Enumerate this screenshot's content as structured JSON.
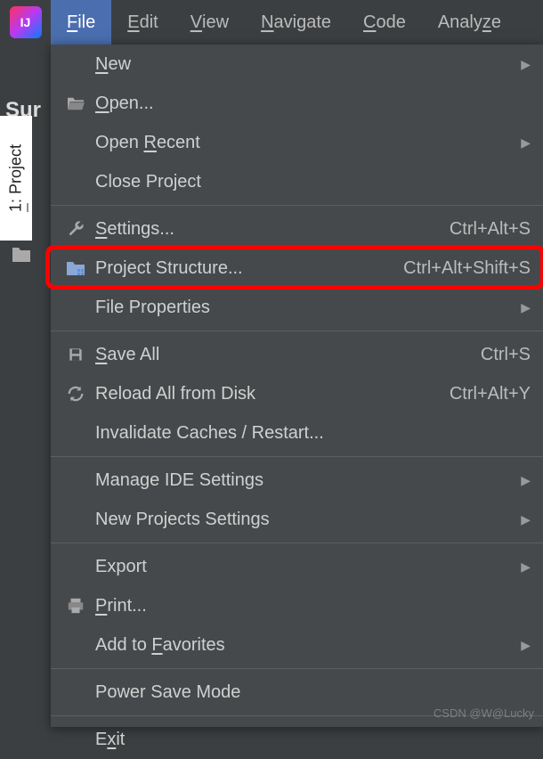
{
  "menubar": {
    "items": [
      {
        "label": "File",
        "mn": "F",
        "active": true
      },
      {
        "label": "Edit",
        "mn": "E",
        "active": false
      },
      {
        "label": "View",
        "mn": "V",
        "active": false
      },
      {
        "label": "Navigate",
        "mn": "N",
        "active": false
      },
      {
        "label": "Code",
        "mn": "C",
        "active": false
      },
      {
        "label": "Analyze",
        "mn": "z",
        "active": false
      }
    ]
  },
  "sidebar": {
    "tab_label": "1: Project",
    "tab_mn": "1",
    "truncated_label": "Sur"
  },
  "dropdown": {
    "items": [
      {
        "type": "item",
        "label": "New",
        "mn": "N",
        "submenu": true,
        "icon": ""
      },
      {
        "type": "item",
        "label": "Open...",
        "mn": "O",
        "icon": "open-folder-icon"
      },
      {
        "type": "item",
        "label": "Open Recent",
        "mn": "R",
        "submenu": true
      },
      {
        "type": "item",
        "label": "Close Project"
      },
      {
        "type": "sep"
      },
      {
        "type": "item",
        "label": "Settings...",
        "mn": "S",
        "shortcut": "Ctrl+Alt+S",
        "icon": "wrench-icon"
      },
      {
        "type": "item",
        "label": "Project Structure...",
        "shortcut": "Ctrl+Alt+Shift+S",
        "icon": "project-structure-icon",
        "highlight": true
      },
      {
        "type": "item",
        "label": "File Properties",
        "submenu": true
      },
      {
        "type": "sep"
      },
      {
        "type": "item",
        "label": "Save All",
        "mn": "S",
        "shortcut": "Ctrl+S",
        "icon": "save-icon"
      },
      {
        "type": "item",
        "label": "Reload All from Disk",
        "shortcut": "Ctrl+Alt+Y",
        "icon": "reload-icon"
      },
      {
        "type": "item",
        "label": "Invalidate Caches / Restart..."
      },
      {
        "type": "sep"
      },
      {
        "type": "item",
        "label": "Manage IDE Settings",
        "submenu": true
      },
      {
        "type": "item",
        "label": "New Projects Settings",
        "submenu": true
      },
      {
        "type": "sep"
      },
      {
        "type": "item",
        "label": "Export",
        "submenu": true
      },
      {
        "type": "item",
        "label": "Print...",
        "mn": "P",
        "icon": "print-icon"
      },
      {
        "type": "item",
        "label": "Add to Favorites",
        "mn": "F",
        "submenu": true
      },
      {
        "type": "sep"
      },
      {
        "type": "item",
        "label": "Power Save Mode"
      },
      {
        "type": "sep"
      },
      {
        "type": "item",
        "label": "Exit",
        "mn": "x"
      }
    ]
  },
  "watermark": "CSDN @W@Lucky"
}
